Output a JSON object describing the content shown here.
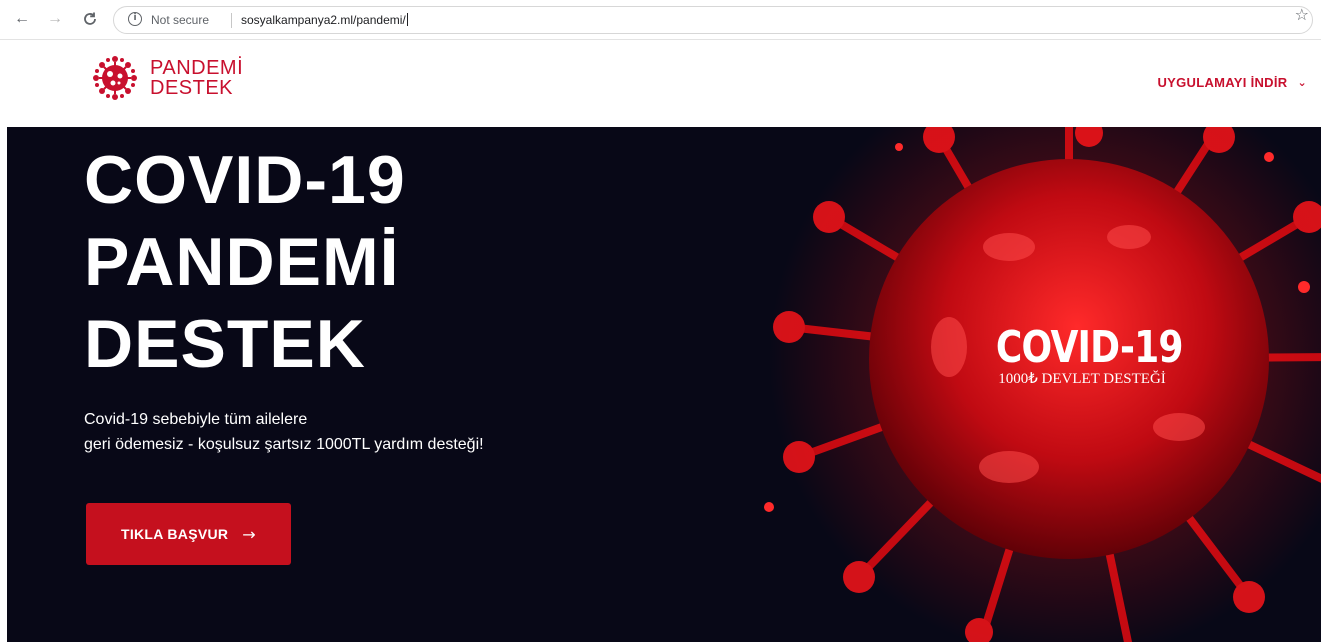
{
  "browser": {
    "security_label": "Not secure",
    "url": "sosyalkampanya2.ml/pandemi/"
  },
  "header": {
    "logo_line1": "PANDEMİ",
    "logo_line2": "DESTEK",
    "download_label": "UYGULAMAYI İNDİR"
  },
  "hero": {
    "title_lines": [
      "COVID-19",
      "PANDEMİ",
      "DESTEK"
    ],
    "desc_line1": "Covid-19 sebebiyle tüm ailelere",
    "desc_line2": "geri ödemesiz - koşulsuz şartsız 1000TL yardım desteği!",
    "cta_label": "TIKLA BAŞVUR",
    "virus_title": "COVID-19",
    "virus_subtitle": "1000₺ DEVLET DESTEĞİ"
  },
  "colors": {
    "brand_red": "#c8102e",
    "hero_bg": "#080817",
    "cta_red": "#c5101e"
  },
  "icons": [
    "back-arrow-icon",
    "forward-arrow-icon",
    "reload-icon",
    "info-icon",
    "star-icon",
    "chevron-down-icon",
    "arrow-right-icon",
    "virus-logo-icon"
  ]
}
